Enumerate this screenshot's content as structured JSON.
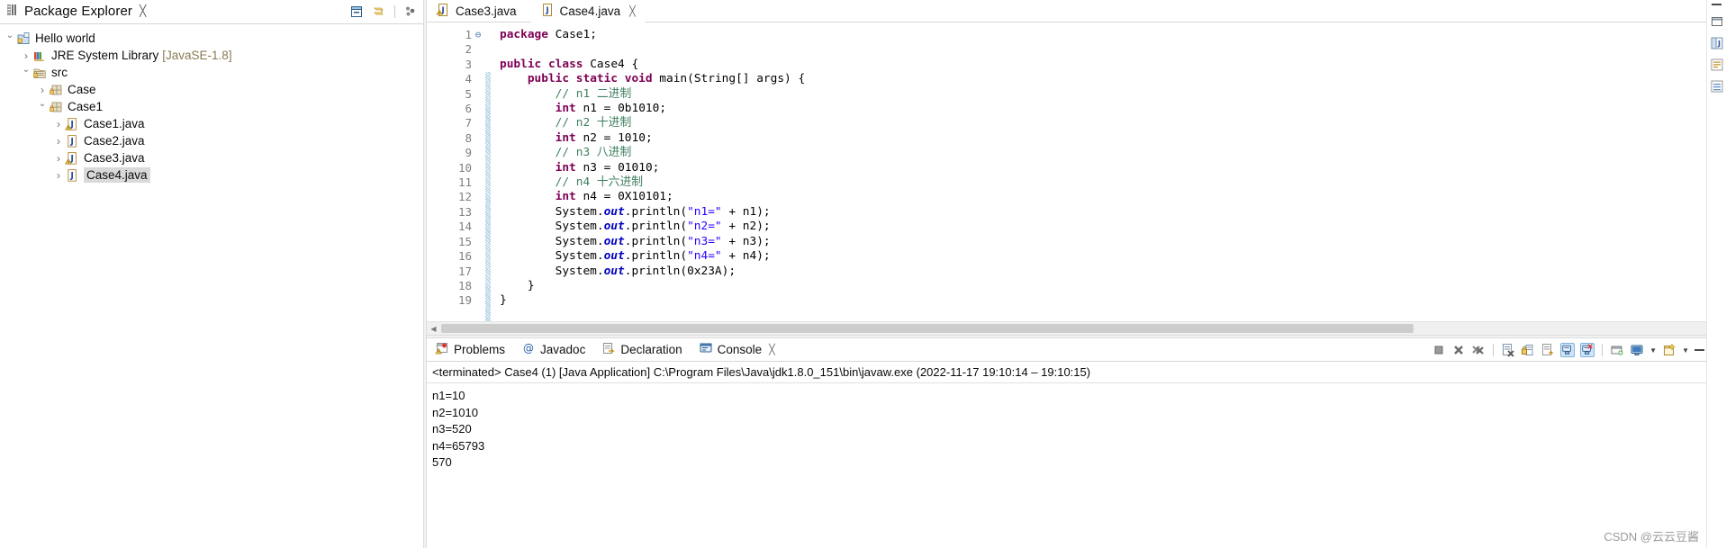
{
  "explorer": {
    "tab_title": "Package Explorer",
    "close_glyph": "╳",
    "toolbar": [
      {
        "name": "collapse-all-icon"
      },
      {
        "name": "link-with-editor-icon"
      },
      {
        "name": "view-menu-icon"
      }
    ],
    "tree": [
      {
        "label": "Hello world",
        "indent": 0,
        "arrow": "open",
        "icon": "java-project-icon",
        "sub": "",
        "selected": false
      },
      {
        "label": "JRE System Library",
        "indent": 1,
        "arrow": "closed",
        "icon": "library-icon",
        "sub": "[JavaSE-1.8]",
        "selected": false
      },
      {
        "label": "src",
        "indent": 1,
        "arrow": "open",
        "icon": "source-folder-icon",
        "sub": "",
        "selected": false
      },
      {
        "label": "Case",
        "indent": 2,
        "arrow": "closed",
        "icon": "package-icon",
        "sub": "",
        "selected": false
      },
      {
        "label": "Case1",
        "indent": 2,
        "arrow": "open",
        "icon": "package-icon",
        "sub": "",
        "selected": false
      },
      {
        "label": "Case1.java",
        "indent": 3,
        "arrow": "closed",
        "icon": "java-file-warning-icon",
        "sub": "",
        "selected": false
      },
      {
        "label": "Case2.java",
        "indent": 3,
        "arrow": "closed",
        "icon": "java-file-icon",
        "sub": "",
        "selected": false
      },
      {
        "label": "Case3.java",
        "indent": 3,
        "arrow": "closed",
        "icon": "java-file-warning-icon",
        "sub": "",
        "selected": false
      },
      {
        "label": "Case4.java",
        "indent": 3,
        "arrow": "closed",
        "icon": "java-file-icon",
        "sub": "",
        "selected": true
      }
    ]
  },
  "editor": {
    "tabs": [
      {
        "label": "Case3.java",
        "active": false,
        "icon": "java-file-warning-icon",
        "closable": false
      },
      {
        "label": "Case4.java",
        "active": true,
        "icon": "java-file-icon",
        "closable": true
      }
    ],
    "close_glyph": "╳",
    "line_numbers": [
      "1",
      "2",
      "3",
      "4",
      "5",
      "6",
      "7",
      "8",
      "9",
      "10",
      "11",
      "12",
      "13",
      "14",
      "15",
      "16",
      "17",
      "18",
      "19"
    ],
    "fold_markers": {
      "4": "⊖"
    },
    "lines": [
      "package Case1;",
      "",
      "public class Case4 {",
      "    public static void main(String[] args) {",
      "        // n1 二进制",
      "        int n1 = 0b1010;",
      "        // n2 十进制",
      "        int n2 = 1010;",
      "        // n3 八进制",
      "        int n3 = 01010;",
      "        // n4 十六进制",
      "        int n4 = 0X10101;",
      "        System.out.println(\"n1=\" + n1);",
      "        System.out.println(\"n2=\" + n2);",
      "        System.out.println(\"n3=\" + n3);",
      "        System.out.println(\"n4=\" + n4);",
      "        System.out.println(0x23A);",
      "    }",
      "}"
    ]
  },
  "console_view": {
    "tabs": [
      {
        "label": "Problems",
        "icon": "problems-icon",
        "active": false,
        "closable": false
      },
      {
        "label": "Javadoc",
        "icon": "javadoc-icon",
        "active": false,
        "closable": false
      },
      {
        "label": "Declaration",
        "icon": "declaration-icon",
        "active": false,
        "closable": false
      },
      {
        "label": "Console",
        "icon": "console-icon",
        "active": true,
        "closable": true
      }
    ],
    "close_glyph": "╳",
    "toolbar": [
      {
        "name": "terminate-icon"
      },
      {
        "name": "remove-launch-icon"
      },
      {
        "name": "remove-all-terminated-icon"
      },
      {
        "name": "clear-console-icon"
      },
      {
        "name": "scroll-lock-icon"
      },
      {
        "name": "word-wrap-icon"
      },
      {
        "name": "show-console-on-output-icon"
      },
      {
        "name": "show-console-on-error-icon"
      },
      {
        "name": "pin-console-icon"
      },
      {
        "name": "display-selected-console-icon"
      },
      {
        "name": "open-console-icon"
      }
    ],
    "terminated_line": "<terminated> Case4 (1) [Java Application] C:\\Program Files\\Java\\jdk1.8.0_151\\bin\\javaw.exe  (2022-11-17 19:10:14 – 19:10:15)",
    "output": [
      "n1=10",
      "n2=1010",
      "n3=520",
      "n4=65793",
      "570"
    ]
  },
  "far_right_toolbar": [
    {
      "name": "restore-perspective-icon"
    },
    {
      "name": "java-perspective-icon"
    },
    {
      "name": "outline-view-icon"
    },
    {
      "name": "task-list-icon"
    }
  ],
  "watermark": "CSDN @云云豆酱",
  "colors": {
    "keyword": "#7f0055",
    "comment": "#3f7f5f",
    "string": "#2a00ff",
    "static_field": "#0000c0",
    "selection": "#d9d9d9",
    "tab_border": "#d6d6d6"
  }
}
